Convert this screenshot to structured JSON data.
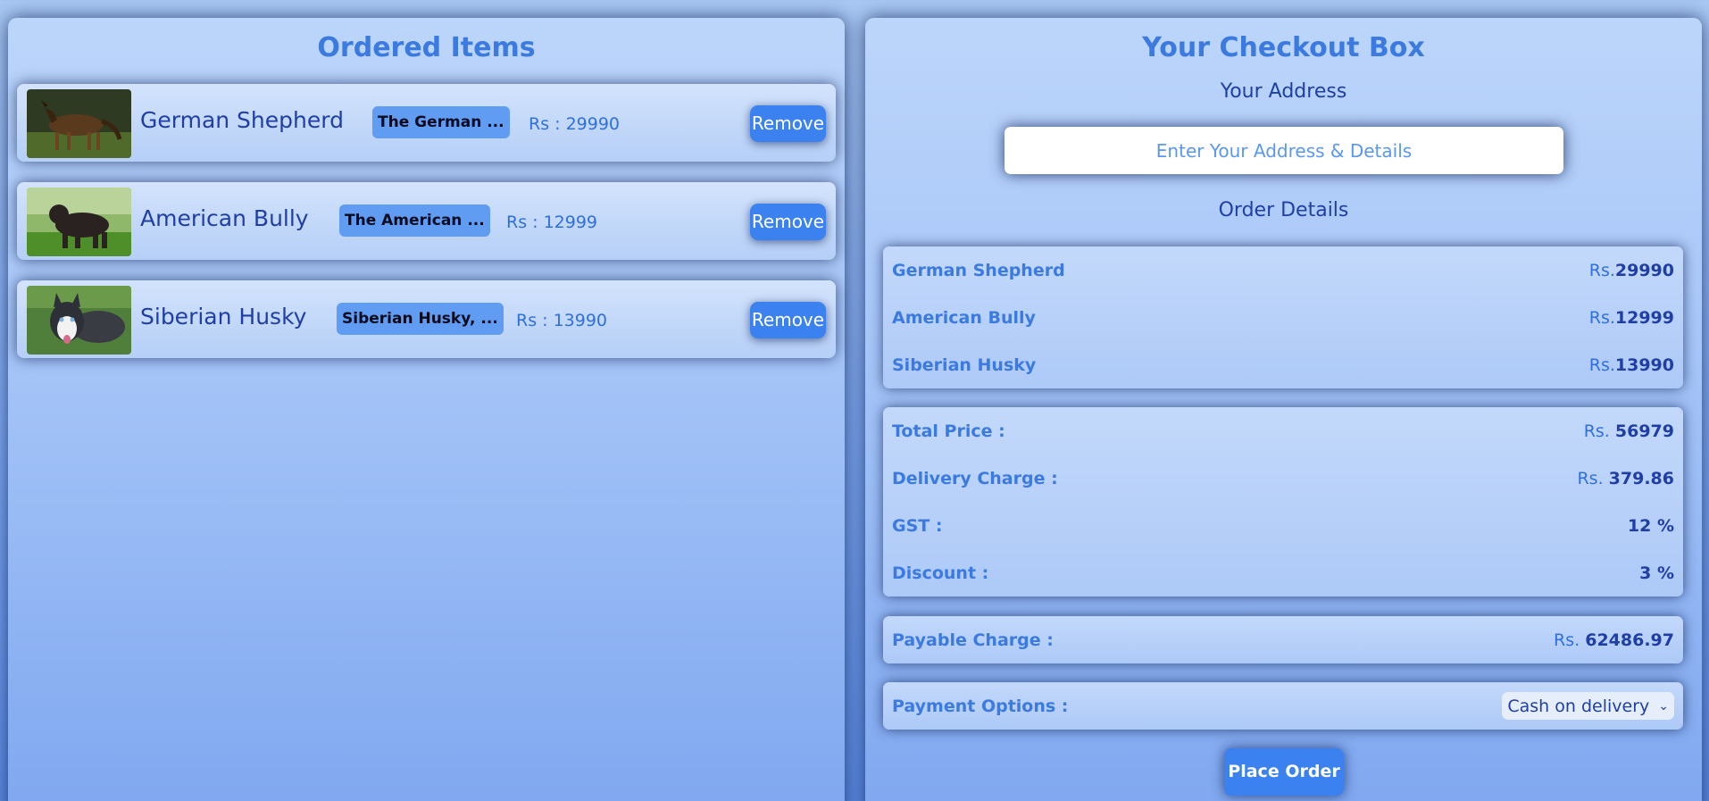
{
  "ordered": {
    "title": "Ordered Items",
    "remove_label": "Remove",
    "items": [
      {
        "name": "German Shepherd",
        "desc": "The German ...",
        "price": "Rs : 29990"
      },
      {
        "name": "American Bully",
        "desc": "The American ...",
        "price": "Rs : 12999"
      },
      {
        "name": "Siberian Husky",
        "desc": "Siberian Husky, ...",
        "price": "Rs : 13990"
      }
    ]
  },
  "checkout": {
    "title": "Your Checkout Box",
    "address_heading": "Your Address",
    "address_placeholder": "Enter Your Address & Details",
    "order_details_heading": "Order Details",
    "order_lines": [
      {
        "label": "German Shepherd",
        "prefix": "Rs.",
        "amount": "29990"
      },
      {
        "label": "American Bully",
        "prefix": "Rs.",
        "amount": "12999"
      },
      {
        "label": "Siberian Husky",
        "prefix": "Rs.",
        "amount": "13990"
      }
    ],
    "summary": [
      {
        "label": "Total Price :",
        "prefix": "Rs. ",
        "amount": "56979"
      },
      {
        "label": "Delivery Charge :",
        "prefix": "Rs. ",
        "amount": "379.86"
      },
      {
        "label": "GST :",
        "prefix": "",
        "amount": "12 %"
      },
      {
        "label": "Discount :",
        "prefix": "",
        "amount": "3 %"
      }
    ],
    "payable": {
      "label": "Payable Charge :",
      "prefix": "Rs. ",
      "amount": "62486.97"
    },
    "payment": {
      "label": "Payment Options :",
      "selected": "Cash on delivery"
    },
    "place_order_label": "Place Order"
  }
}
